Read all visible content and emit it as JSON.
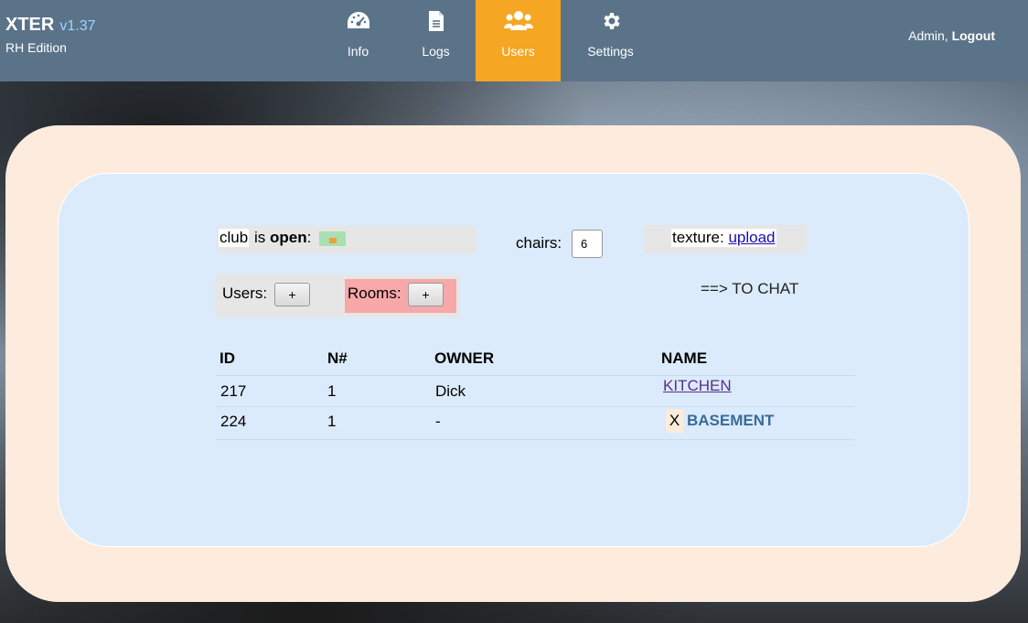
{
  "nav": {
    "brand": "XTER",
    "version": "v1.37",
    "edition": "RH Edition",
    "tabs": [
      {
        "label": "Info",
        "icon": "dashboard-icon"
      },
      {
        "label": "Logs",
        "icon": "document-icon"
      },
      {
        "label": "Users",
        "icon": "users-icon",
        "active": true
      },
      {
        "label": "Settings",
        "icon": "gear-icon"
      }
    ],
    "user": "Admin,",
    "logout": "Logout",
    "active_color": "#f5a623",
    "bar_color": "#5b7389"
  },
  "controls": {
    "club_word": "club",
    "club_is": "is",
    "club_state": "open",
    "club_colon": ":",
    "chairs_label": "chairs:",
    "chairs_value": "6",
    "texture_label": "texture:",
    "texture_link": "upload",
    "users_label": "Users:",
    "rooms_label": "Rooms:",
    "plus": "+",
    "to_chat": "==> TO CHAT"
  },
  "table": {
    "headers": [
      "ID",
      "N#",
      "OWNER",
      "NAME"
    ],
    "rows": [
      {
        "id": "217",
        "n": "1",
        "owner": "Dick",
        "name": "KITCHEN",
        "delete": ""
      },
      {
        "id": "224",
        "n": "1",
        "owner": "-",
        "name": "BASEMENT",
        "delete": "X"
      }
    ]
  }
}
